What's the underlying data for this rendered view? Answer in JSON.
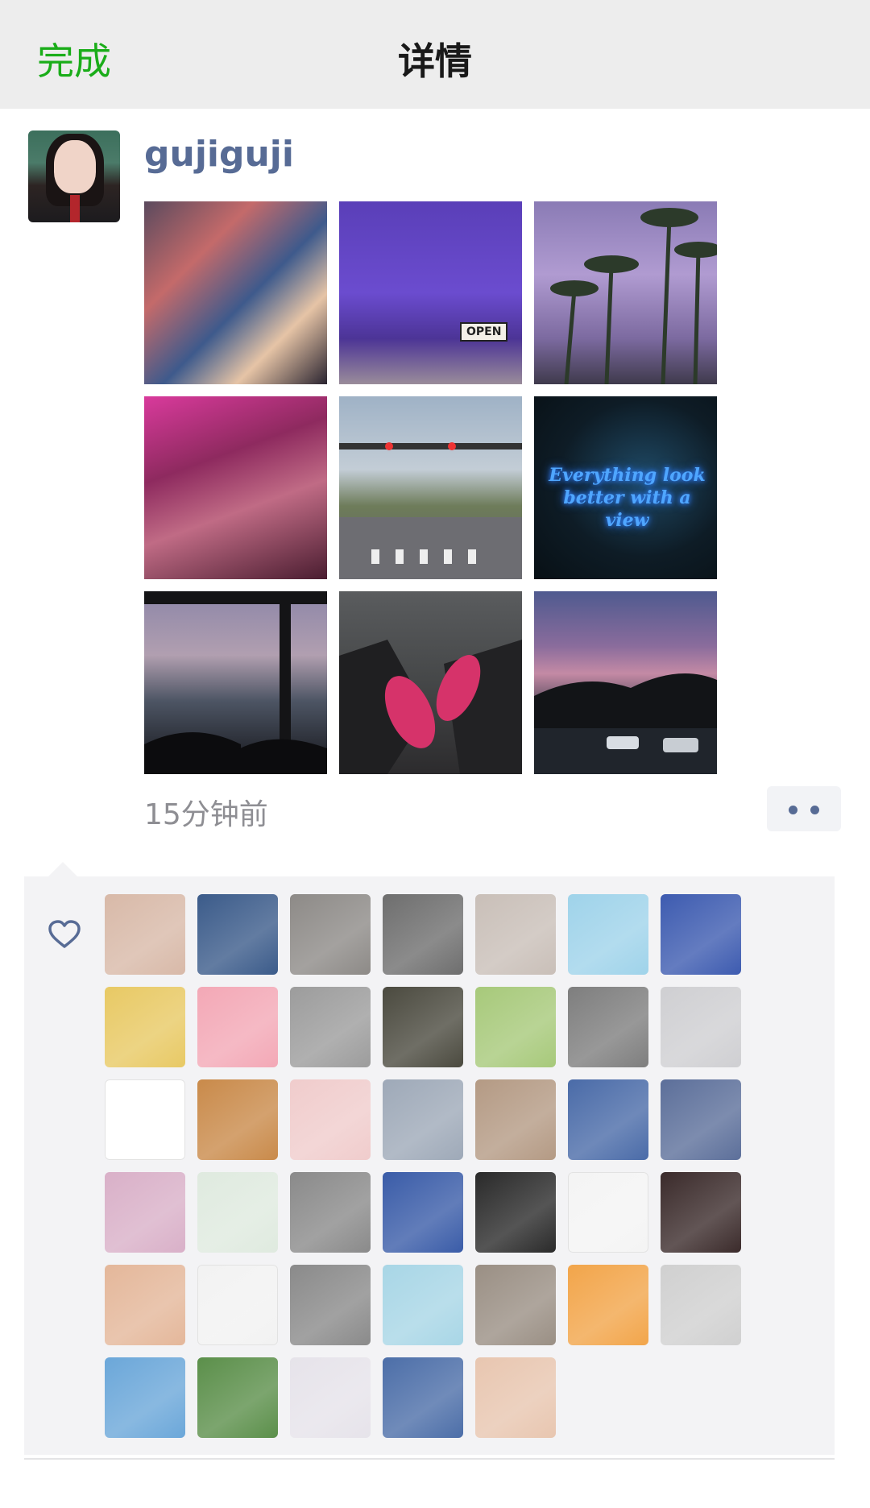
{
  "nav": {
    "done_label": "完成",
    "title": "详情"
  },
  "post": {
    "author": "gujiguji",
    "time": "15分钟前",
    "photos": [
      {
        "name": "poster-wall"
      },
      {
        "name": "purple-shopfront",
        "sign": "OPEN"
      },
      {
        "name": "palm-trees"
      },
      {
        "name": "neon-street"
      },
      {
        "name": "crosswalk"
      },
      {
        "name": "neon-sign",
        "text": "Everything look better with a view"
      },
      {
        "name": "bus-window"
      },
      {
        "name": "pink-sneakers"
      },
      {
        "name": "dusk-road"
      }
    ]
  },
  "likes": {
    "icon": "heart-icon",
    "count_rows": 6,
    "avatars": [
      {
        "name": "girl-portrait",
        "color": "#d8b9a8"
      },
      {
        "name": "city-aerial",
        "color": "#3b5b8a"
      },
      {
        "name": "red-sports-car",
        "color": "#8d8a87"
      },
      {
        "name": "bw-sleeping",
        "color": "#6e6e6e"
      },
      {
        "name": "shadow-girl",
        "color": "#c9bfb8"
      },
      {
        "name": "anime-blue-hair",
        "color": "#9fd3ea"
      },
      {
        "name": "blue-flowers",
        "color": "#3d5bb0"
      },
      {
        "name": "alice-cartoon",
        "color": "#e8c964"
      },
      {
        "name": "pink-pig",
        "color": "#f3a8b6"
      },
      {
        "name": "marble-bust",
        "color": "#9c9c9c"
      },
      {
        "name": "wayfarer-logo",
        "color": "#4b4a3f"
      },
      {
        "name": "anime-girl-kimono",
        "color": "#a7c97a"
      },
      {
        "name": "bw-anime",
        "color": "#7e7e7e"
      },
      {
        "name": "silver-car",
        "color": "#cfcfd2"
      },
      {
        "name": "hamster-sticker",
        "color": "#ffffff"
      },
      {
        "name": "shiba-dog",
        "color": "#c98a4a"
      },
      {
        "name": "anime-sketch-girl",
        "color": "#f0cccc"
      },
      {
        "name": "cloudy-sky",
        "color": "#9ea9b8"
      },
      {
        "name": "cat-closeup",
        "color": "#b49a84"
      },
      {
        "name": "tom-cartoon",
        "color": "#4a6ba8"
      },
      {
        "name": "blue-anime-figure",
        "color": "#5c6f9a"
      },
      {
        "name": "cherry-blossom",
        "color": "#d9b0c8"
      },
      {
        "name": "giraffe-drawing",
        "color": "#dfeadf"
      },
      {
        "name": "sunglasses-man",
        "color": "#8a8a8a"
      },
      {
        "name": "flower-dress-girl",
        "color": "#3a5ca8"
      },
      {
        "name": "black-hair-sunglasses",
        "color": "#2a2a2a"
      },
      {
        "name": "ghost-doodle",
        "color": "#f4f4f4"
      },
      {
        "name": "bob-hair-girl",
        "color": "#3b2b2b"
      },
      {
        "name": "long-hair-drawing",
        "color": "#e4b79a"
      },
      {
        "name": "tiger-sketch",
        "color": "#f2f2f2"
      },
      {
        "name": "bw-woman-cat",
        "color": "#8a8a8a"
      },
      {
        "name": "green-blur",
        "color": "#a8d6e6"
      },
      {
        "name": "flower-crown-girl",
        "color": "#9a8f84"
      },
      {
        "name": "anime-straw-hat",
        "color": "#f2a54a"
      },
      {
        "name": "cat-sketch",
        "color": "#d0d0d0"
      },
      {
        "name": "seaside-man",
        "color": "#6ba7d9"
      },
      {
        "name": "mountain-lake",
        "color": "#5b8f4a"
      },
      {
        "name": "sesshomaru",
        "color": "#e6e3ea"
      },
      {
        "name": "anime-dark-hair",
        "color": "#4c6ea8"
      },
      {
        "name": "orange-cat",
        "color": "#e8c6b0"
      }
    ]
  }
}
